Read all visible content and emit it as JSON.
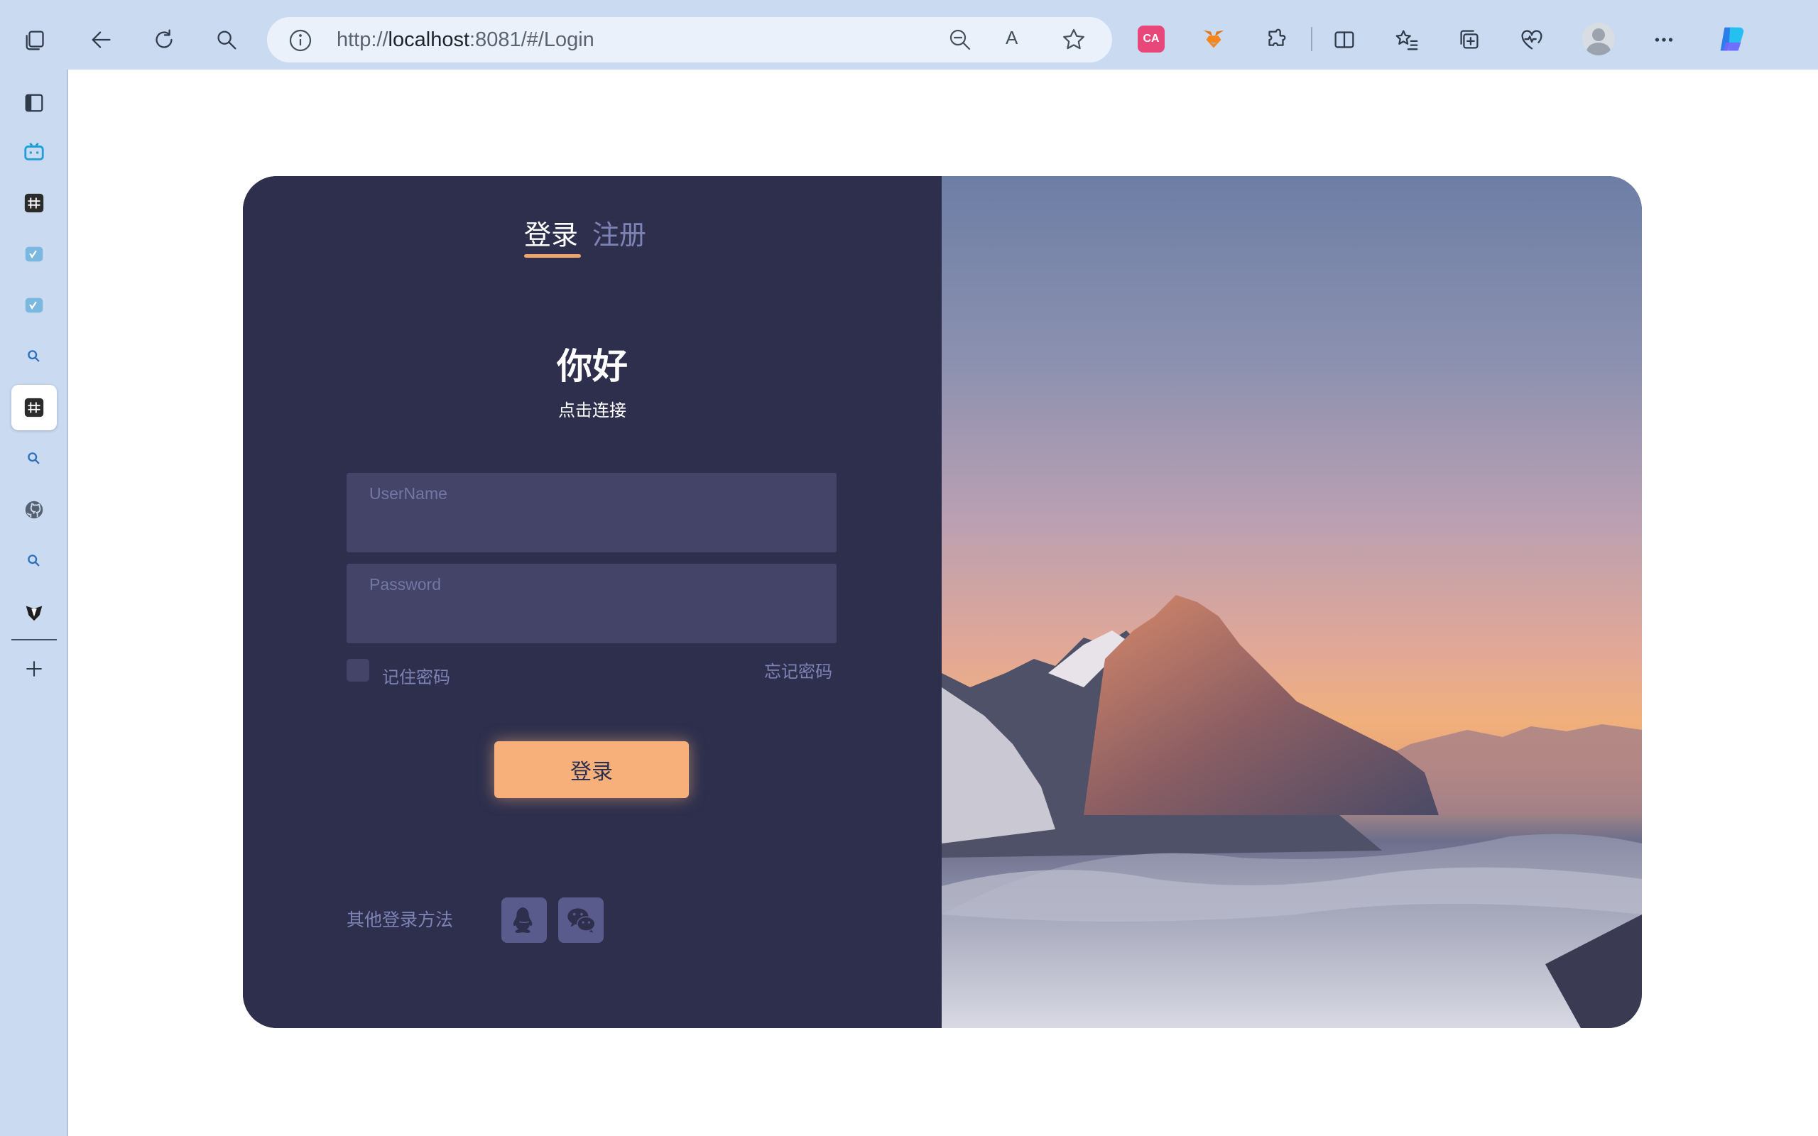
{
  "browser": {
    "url_prefix": "http://",
    "url_host": "localhost",
    "url_rest": ":8081/#/Login",
    "read_aloud_label": "A",
    "ext_translate_label": "CA"
  },
  "login": {
    "tab_login": "登录",
    "tab_register": "注册",
    "greeting": "你好",
    "subtitle": "点击连接",
    "username_placeholder": "UserName",
    "password_placeholder": "Password",
    "remember_label": "记住密码",
    "forgot_label": "忘记密码",
    "submit_label": "登录",
    "other_methods_label": "其他登录方法"
  },
  "colors": {
    "panel_bg": "#2d2f4d",
    "input_bg": "#434467",
    "accent": "#f7b07a",
    "muted_text": "#7e83b6",
    "browser_chrome": "#c9daf1"
  },
  "icons": {
    "social": [
      "qq-icon",
      "wechat-icon"
    ]
  }
}
